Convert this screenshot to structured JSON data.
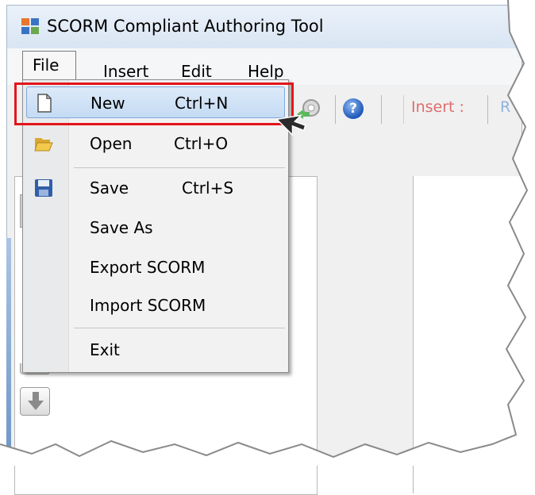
{
  "window": {
    "title": "SCORM Compliant Authoring Tool"
  },
  "menubar": {
    "items": [
      {
        "label": "File"
      },
      {
        "label": "Insert"
      },
      {
        "label": "Edit"
      },
      {
        "label": "Help"
      }
    ]
  },
  "toolbar": {
    "insert_label": "Insert :",
    "trailing_label": "R"
  },
  "file_menu": {
    "items": [
      {
        "label": "New",
        "shortcut": "Ctrl+N",
        "icon": "new-document-icon",
        "highlighted": true
      },
      {
        "label": "Open",
        "shortcut": "Ctrl+O",
        "icon": "open-folder-icon"
      },
      {
        "label": "Save",
        "shortcut": "Ctrl+S",
        "icon": "save-disk-icon"
      },
      {
        "label": "Save As",
        "shortcut": ""
      },
      {
        "label": "Export SCORM",
        "shortcut": ""
      },
      {
        "label": "Import SCORM",
        "shortcut": ""
      },
      {
        "label": "Exit",
        "shortcut": ""
      }
    ]
  },
  "colors": {
    "highlight_border": "#e3151a",
    "menu_highlight": "#c4dbf4",
    "insert_label": "#e06b6b"
  },
  "icons": [
    "app-icon",
    "gear-icon",
    "help-icon",
    "down-arrow-icon",
    "mouse-cursor-icon"
  ]
}
